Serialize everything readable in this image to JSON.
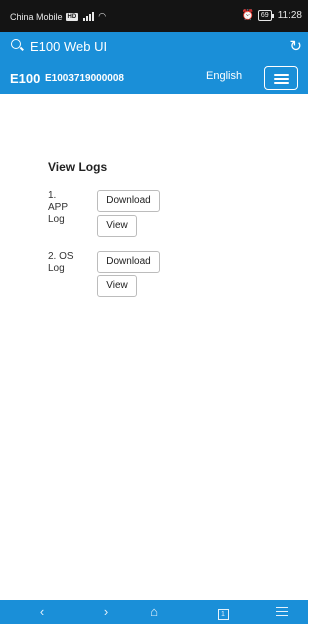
{
  "status_bar": {
    "carrier": "China Mobile",
    "hd_badge": "HD",
    "alarm_icon": "alarm-icon",
    "battery": "69",
    "time": "11:28"
  },
  "browser": {
    "url": "E100 Web UI"
  },
  "header": {
    "brand": "E100",
    "serial": "E1003719000008",
    "language": "English"
  },
  "logs": {
    "title": "View Logs",
    "items": [
      {
        "label_line1": "1.",
        "label_line2": "APP",
        "label_line3": "Log",
        "download": "Download",
        "view": "View"
      },
      {
        "label_line1": "2. OS",
        "label_line2": "Log",
        "download": "Download",
        "view": "View"
      }
    ]
  },
  "colors": {
    "primary": "#1a8fd8",
    "status_bar": "#141414"
  }
}
